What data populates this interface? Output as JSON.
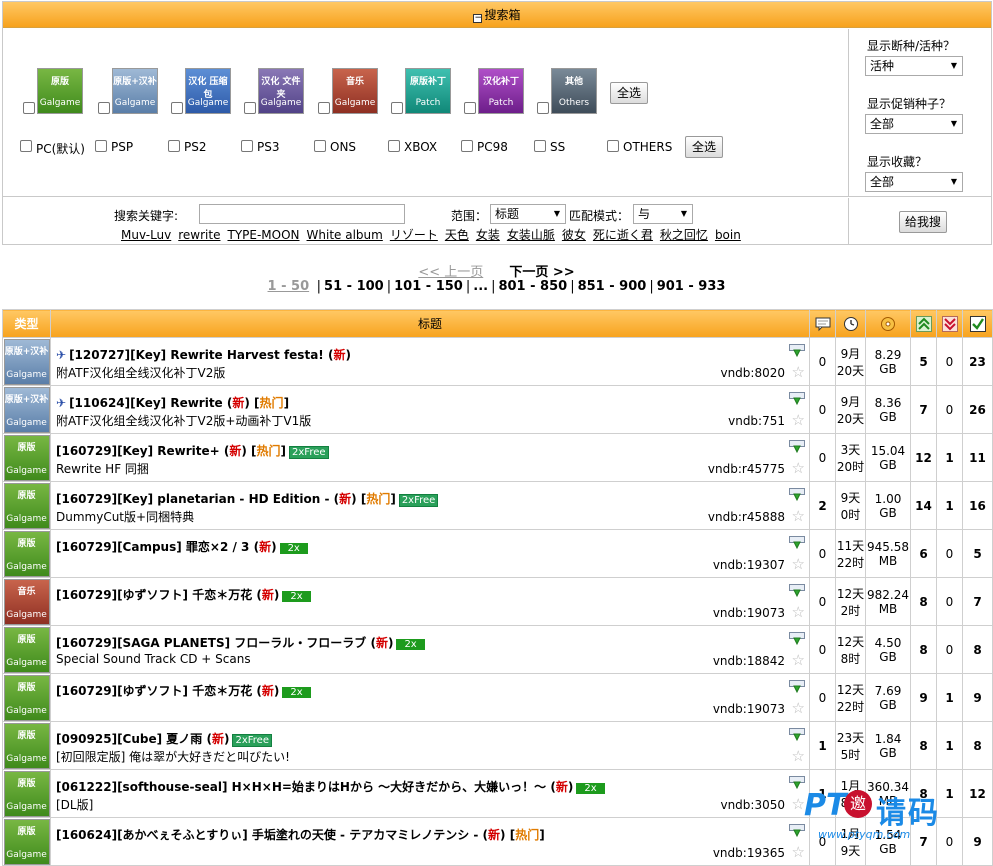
{
  "search": {
    "title": "搜索箱",
    "categories": [
      {
        "line1": "原版",
        "line2": "Galgame",
        "color": "green"
      },
      {
        "line1": "原版+汉补",
        "line2": "Galgame",
        "color": "blue1"
      },
      {
        "line1": "汉化 压缩包",
        "line2": "Galgame",
        "color": "blue2"
      },
      {
        "line1": "汉化 文件夹",
        "line2": "Galgame",
        "color": "purple"
      },
      {
        "line1": "音乐",
        "line2": "Galgame",
        "color": "red"
      },
      {
        "line1": "原版补丁",
        "line2": "Patch",
        "color": "teal"
      },
      {
        "line1": "汉化补丁",
        "line2": "Patch",
        "color": "magenta"
      },
      {
        "line1": "其他",
        "line2": "Others",
        "color": "slate"
      }
    ],
    "select_all_label": "全选",
    "platforms": [
      "PC(默认)",
      "PSP",
      "PS2",
      "PS3",
      "ONS",
      "XBOX",
      "PC98",
      "SS",
      "OTHERS"
    ],
    "side": {
      "alive_label": "显示断种/活种？",
      "alive_value": "活种",
      "promo_label": "显示促销种子？",
      "promo_value": "全部",
      "fav_label": "显示收藏？",
      "fav_value": "全部"
    },
    "keyword_label": "搜索关键字:",
    "keyword_value": "",
    "scope_label": "范围：",
    "scope_value": "标题",
    "mode_label": "匹配模式：",
    "mode_value": "与",
    "go_label": "给我搜",
    "hot_links": [
      "Muv-Luv",
      "rewrite",
      "TYPE-MOON",
      "White album",
      "リゾート",
      "天色",
      "女装",
      "女装山脈",
      "彼女",
      "死に逝く君",
      "秋之回忆",
      "boin"
    ]
  },
  "pager": {
    "prev": "<< 上一页",
    "next": "下一页 >>",
    "current": "1 - 50",
    "pages": [
      "51 - 100",
      "101 - 150",
      "...",
      "801 - 850",
      "851 - 900",
      "901 - 933"
    ]
  },
  "table": {
    "type_header": "类型",
    "title_header": "标题",
    "rows": [
      {
        "cat": "原版+汉补",
        "cat2": "Galgame",
        "color": "blue1",
        "pin": true,
        "name": "[120727][Key] Rewrite Harvest festa!",
        "new": "新",
        "hot": "",
        "promo": "",
        "sub": "附ATF汉化组全线汉化补丁V2版",
        "vndb": "vndb:8020",
        "comments": "0",
        "time1": "9月",
        "time2": "20天",
        "size1": "8.29",
        "size2": "GB",
        "seeders": "5",
        "leechers": "0",
        "completed": "23"
      },
      {
        "cat": "原版+汉补",
        "cat2": "Galgame",
        "color": "blue1",
        "pin": true,
        "name": "[110624][Key] Rewrite",
        "new": "新",
        "hot": "热门",
        "promo": "",
        "sub": "附ATF汉化组全线汉化补丁V2版+动画补丁V1版",
        "vndb": "vndb:751",
        "comments": "0",
        "time1": "9月",
        "time2": "20天",
        "size1": "8.36",
        "size2": "GB",
        "seeders": "7",
        "leechers": "0",
        "completed": "26"
      },
      {
        "cat": "原版",
        "cat2": "Galgame",
        "color": "green",
        "pin": false,
        "name": "[160729][Key] Rewrite+",
        "new": "新",
        "hot": "热门",
        "promo": "2xFree",
        "sub": "Rewrite HF 同捆",
        "vndb": "vndb:r45775",
        "comments": "0",
        "time1": "3天",
        "time2": "20时",
        "size1": "15.04",
        "size2": "GB",
        "seeders": "12",
        "leechers": "1",
        "completed": "11"
      },
      {
        "cat": "原版",
        "cat2": "Galgame",
        "color": "green",
        "pin": false,
        "name": "[160729][Key] planetarian - HD Edition -",
        "new": "新",
        "hot": "热门",
        "promo": "2xFree",
        "sub": "DummyCut版+同梱特典",
        "vndb": "vndb:r45888",
        "comments": "2",
        "time1": "9天",
        "time2": "0时",
        "size1": "1.00",
        "size2": "GB",
        "seeders": "14",
        "leechers": "1",
        "completed": "16"
      },
      {
        "cat": "原版",
        "cat2": "Galgame",
        "color": "green",
        "pin": false,
        "name": "[160729][Campus] 罪恋×2 / 3",
        "new": "新",
        "hot": "",
        "promo": "2x",
        "sub": "",
        "vndb": "vndb:19307",
        "comments": "0",
        "time1": "11天",
        "time2": "22时",
        "size1": "945.58",
        "size2": "MB",
        "seeders": "6",
        "leechers": "0",
        "completed": "5"
      },
      {
        "cat": "音乐",
        "cat2": "Galgame",
        "color": "red",
        "pin": false,
        "name": "[160729][ゆずソフト] 千恋＊万花",
        "new": "新",
        "hot": "",
        "promo": "2x",
        "sub": "",
        "vndb": "vndb:19073",
        "comments": "0",
        "time1": "12天",
        "time2": "2时",
        "size1": "982.24",
        "size2": "MB",
        "seeders": "8",
        "leechers": "0",
        "completed": "7"
      },
      {
        "cat": "原版",
        "cat2": "Galgame",
        "color": "green",
        "pin": false,
        "name": "[160729][SAGA PLANETS] フローラル・フローラブ",
        "new": "新",
        "hot": "",
        "promo": "2x",
        "sub": "Special Sound Track CD + Scans",
        "vndb": "vndb:18842",
        "comments": "0",
        "time1": "12天",
        "time2": "8时",
        "size1": "4.50",
        "size2": "GB",
        "seeders": "8",
        "leechers": "0",
        "completed": "8"
      },
      {
        "cat": "原版",
        "cat2": "Galgame",
        "color": "green",
        "pin": false,
        "name": "[160729][ゆずソフト] 千恋＊万花",
        "new": "新",
        "hot": "",
        "promo": "2x",
        "sub": "",
        "vndb": "vndb:19073",
        "comments": "0",
        "time1": "12天",
        "time2": "22时",
        "size1": "7.69",
        "size2": "GB",
        "seeders": "9",
        "leechers": "1",
        "completed": "9"
      },
      {
        "cat": "原版",
        "cat2": "Galgame",
        "color": "green",
        "pin": false,
        "name": "[090925][Cube] 夏ノ雨",
        "new": "新",
        "hot": "",
        "promo": "2xFree",
        "sub": "[初回限定版] 俺は翠が大好きだと叫びたい!",
        "vndb": "",
        "comments": "1",
        "time1": "23天",
        "time2": "5时",
        "size1": "1.84",
        "size2": "GB",
        "seeders": "8",
        "leechers": "1",
        "completed": "8"
      },
      {
        "cat": "原版",
        "cat2": "Galgame",
        "color": "green",
        "pin": false,
        "name": "[061222][softhouse-seal] H×H×H=始まりはHから ～大好きだから、大嫌いっ！～",
        "new": "新",
        "hot": "",
        "promo": "2x",
        "sub": "[DL版]",
        "vndb": "vndb:3050",
        "comments": "1",
        "time1": "1月",
        "time2": "8天",
        "size1": "360.34",
        "size2": "MB",
        "seeders": "8",
        "leechers": "1",
        "completed": "12"
      },
      {
        "cat": "原版",
        "cat2": "Galgame",
        "color": "green",
        "pin": false,
        "name": "[160624][あかべぇそふとすりぃ] 手垢塗れの天使 - テアカマミレノテンシ -",
        "new": "新",
        "hot": "热门",
        "promo": "",
        "sub": "",
        "vndb": "vndb:19365",
        "comments": "0",
        "time1": "1月",
        "time2": "9天",
        "size1": "1.54",
        "size2": "GB",
        "seeders": "7",
        "leechers": "0",
        "completed": "9"
      }
    ]
  },
  "watermark": {
    "a": "PT",
    "b": "邀",
    "c": "请码",
    "d": "www.ptyqm.com"
  }
}
